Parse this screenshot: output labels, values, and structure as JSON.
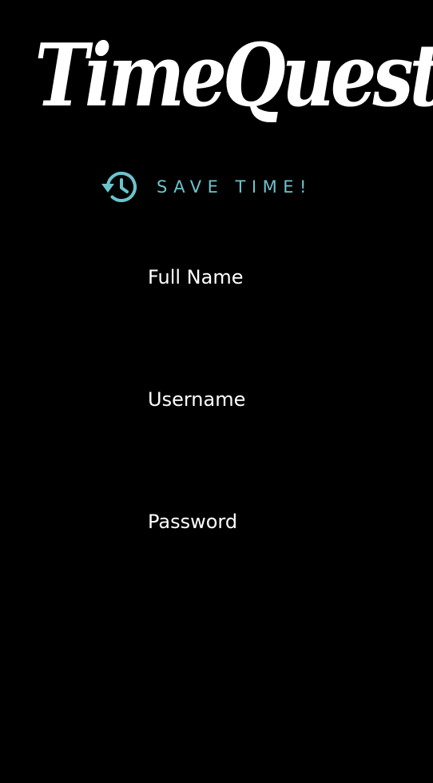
{
  "logo": {
    "text": "TimeQuest"
  },
  "tagline": {
    "icon": "history-icon",
    "text": "SAVE TIME!",
    "color": "#6cc3cc"
  },
  "form": {
    "full_name": {
      "label": "Full Name",
      "value": ""
    },
    "username": {
      "label": "Username",
      "value": ""
    },
    "password": {
      "label": "Password",
      "value": ""
    }
  },
  "colors": {
    "background": "#000000",
    "text": "#ffffff",
    "accent": "#6cc3cc"
  }
}
